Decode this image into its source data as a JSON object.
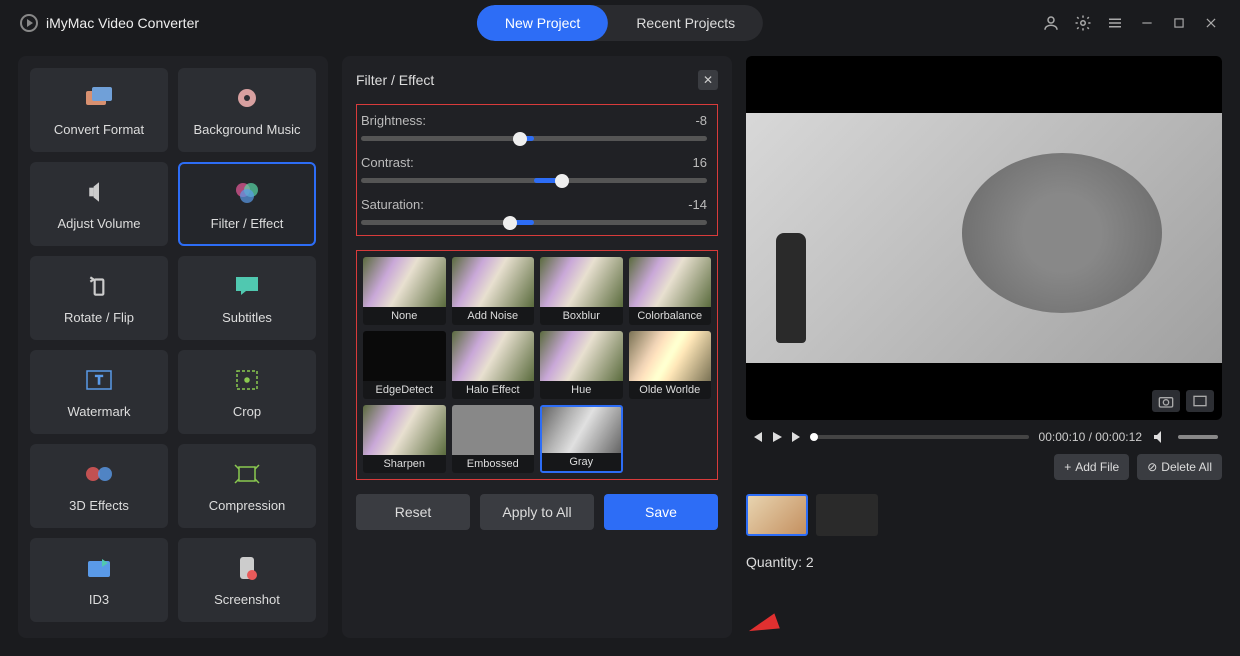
{
  "app": {
    "title": "iMyMac Video Converter"
  },
  "tabs": {
    "new_project": "New Project",
    "recent_projects": "Recent Projects"
  },
  "tools": [
    {
      "label": "Convert Format"
    },
    {
      "label": "Background Music"
    },
    {
      "label": "Adjust Volume"
    },
    {
      "label": "Filter / Effect"
    },
    {
      "label": "Rotate / Flip"
    },
    {
      "label": "Subtitles"
    },
    {
      "label": "Watermark"
    },
    {
      "label": "Crop"
    },
    {
      "label": "3D Effects"
    },
    {
      "label": "Compression"
    },
    {
      "label": "ID3"
    },
    {
      "label": "Screenshot"
    }
  ],
  "filter_panel": {
    "title": "Filter / Effect",
    "sliders": {
      "brightness": {
        "label": "Brightness:",
        "value": "-8",
        "pct": 46
      },
      "contrast": {
        "label": "Contrast:",
        "value": "16",
        "pct": 58
      },
      "saturation": {
        "label": "Saturation:",
        "value": "-14",
        "pct": 43
      }
    },
    "filters": [
      "None",
      "Add Noise",
      "Boxblur",
      "Colorbalance",
      "EdgeDetect",
      "Halo Effect",
      "Hue",
      "Olde Worlde",
      "Sharpen",
      "Embossed",
      "Gray"
    ],
    "selected_filter": 10,
    "actions": {
      "reset": "Reset",
      "apply_all": "Apply to All",
      "save": "Save"
    }
  },
  "preview": {
    "time_current": "00:00:10",
    "time_total": "00:00:12",
    "add_file": "Add File",
    "delete_all": "Delete All",
    "quantity_label": "Quantity: 2"
  }
}
